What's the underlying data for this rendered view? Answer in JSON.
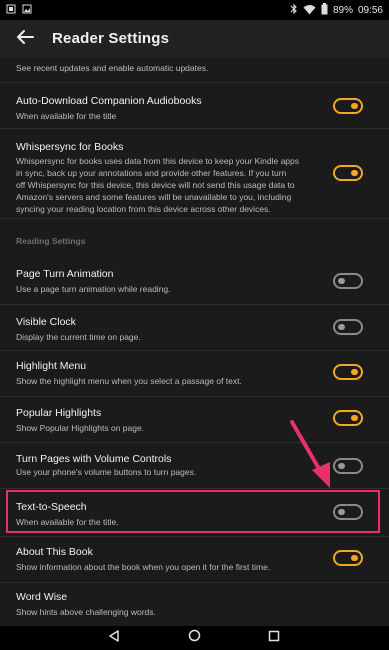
{
  "status_bar": {
    "battery": "89%",
    "time": "09:56"
  },
  "app_bar": {
    "title": "Reader Settings"
  },
  "top_note": "See recent updates and enable automatic updates.",
  "sections": {
    "reading_settings_label": "Reading Settings"
  },
  "settings": [
    {
      "title": "Auto-Download Companion Audiobooks",
      "desc": "When available for the title",
      "on": true
    },
    {
      "title": "Whispersync for Books",
      "desc_lines": [
        "Whispersync for books uses data from this device to keep your Kindle apps",
        "in sync, back up your annotations and provide other features. If you turn",
        "off Whispersync for this device, this device will not send this usage data to",
        "Amazon's servers and some features will be unavailable to you, including",
        "syncing your reading location from this device across other devices."
      ],
      "on": true
    },
    {
      "title": "Page Turn Animation",
      "desc": "Use a page turn animation while reading.",
      "on": false
    },
    {
      "title": "Visible Clock",
      "desc": "Display the current time on page.",
      "on": false
    },
    {
      "title": "Highlight Menu",
      "desc": "Show the highlight menu when you select a passage of text.",
      "on": true
    },
    {
      "title": "Popular Highlights",
      "desc": "Show Popular Highlights on page.",
      "on": true
    },
    {
      "title": "Turn Pages with Volume Controls",
      "desc": "Use your phone's volume buttons to turn pages.",
      "on": false
    },
    {
      "title": "Text-to-Speech",
      "desc": "When available for the title.",
      "on": false
    },
    {
      "title": "About This Book",
      "desc": "Show information about the book when you open it for the first time.",
      "on": true
    },
    {
      "title": "Word Wise",
      "desc": "Show hints above challenging words.",
      "on": null
    }
  ],
  "colors": {
    "toggle_on": "#f5a623",
    "toggle_off": "#8a8a8a",
    "annotation": "#e8316b"
  },
  "icons": {
    "back": "arrow-left-icon",
    "nav_back": "triangle-back-icon",
    "nav_home": "circle-home-icon",
    "nav_recents": "square-recents-icon"
  }
}
